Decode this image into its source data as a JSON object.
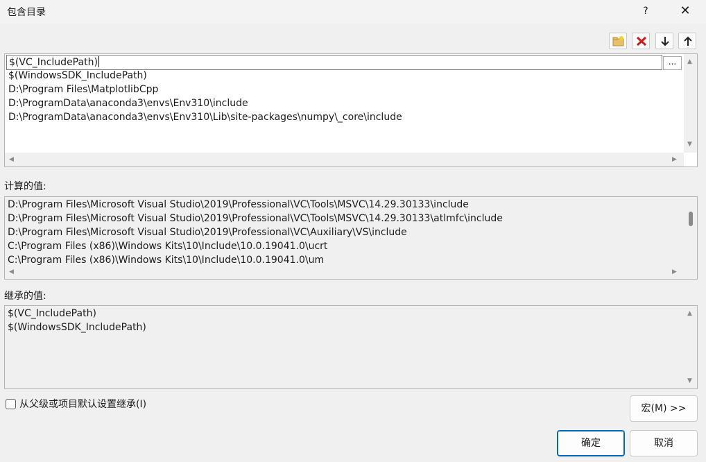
{
  "window": {
    "title": "包含目录",
    "help": "?",
    "close": "✕"
  },
  "toolbar": {
    "new_line_icon": "folder-new-icon",
    "delete_icon": "delete-x-icon",
    "move_down_icon": "arrow-down-icon",
    "move_up_icon": "arrow-up-icon"
  },
  "editor": {
    "first_line_value": "$(VC_IncludePath)",
    "lines": [
      "$(WindowsSDK_IncludePath)",
      "D:\\Program Files\\MatplotlibCpp",
      "D:\\ProgramData\\anaconda3\\envs\\Env310\\include",
      "D:\\ProgramData\\anaconda3\\envs\\Env310\\Lib\\site-packages\\numpy\\_core\\include"
    ],
    "browse_button": "..."
  },
  "evaluated": {
    "label": "计算的值:",
    "lines": [
      "D:\\Program Files\\Microsoft Visual Studio\\2019\\Professional\\VC\\Tools\\MSVC\\14.29.30133\\include",
      "D:\\Program Files\\Microsoft Visual Studio\\2019\\Professional\\VC\\Tools\\MSVC\\14.29.30133\\atlmfc\\include",
      "D:\\Program Files\\Microsoft Visual Studio\\2019\\Professional\\VC\\Auxiliary\\VS\\include",
      "C:\\Program Files (x86)\\Windows Kits\\10\\Include\\10.0.19041.0\\ucrt",
      "C:\\Program Files (x86)\\Windows Kits\\10\\Include\\10.0.19041.0\\um"
    ]
  },
  "inherited": {
    "label": "继承的值:",
    "lines": [
      "$(VC_IncludePath)",
      "$(WindowsSDK_IncludePath)"
    ]
  },
  "inherit_checkbox": {
    "label": "从父级或项目默认设置继承(I)",
    "checked": false
  },
  "buttons": {
    "macros": "宏(M) >>",
    "ok": "确定",
    "cancel": "取消"
  }
}
